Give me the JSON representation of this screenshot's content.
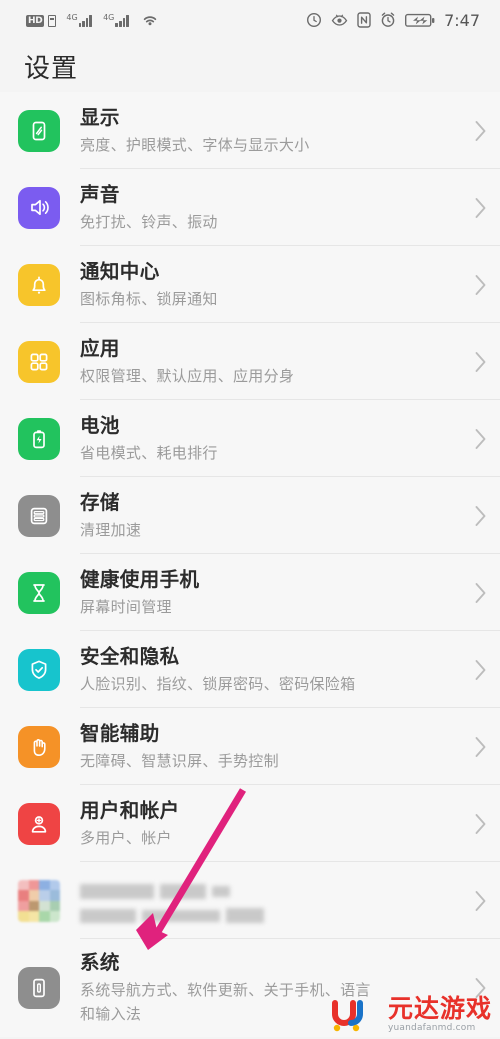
{
  "status_bar": {
    "hd_label": "HD",
    "sim_icon": "sim-card-icon",
    "network_1": "4G",
    "network_2": "4G",
    "wifi_icon": "wifi-icon",
    "right_icons": [
      "data-saver-icon",
      "eye-comfort-icon",
      "nfc-icon",
      "alarm-icon",
      "battery-charging-icon"
    ],
    "time": "7:47"
  },
  "header": {
    "title": "设置"
  },
  "list": {
    "items": [
      {
        "name": "display",
        "title": "显示",
        "subtitle": "亮度、护眼模式、字体与显示大小",
        "icon": "display-icon",
        "icon_color": "#22c35e",
        "blurred": false
      },
      {
        "name": "sound",
        "title": "声音",
        "subtitle": "免打扰、铃声、振动",
        "icon": "speaker-icon",
        "icon_color": "#7b5cf0",
        "blurred": false
      },
      {
        "name": "notification-center",
        "title": "通知中心",
        "subtitle": "图标角标、锁屏通知",
        "icon": "bell-icon",
        "icon_color": "#f7c52b",
        "blurred": false
      },
      {
        "name": "apps",
        "title": "应用",
        "subtitle": "权限管理、默认应用、应用分身",
        "icon": "apps-grid-icon",
        "icon_color": "#f7c52b",
        "blurred": false
      },
      {
        "name": "battery",
        "title": "电池",
        "subtitle": "省电模式、耗电排行",
        "icon": "battery-icon",
        "icon_color": "#22c35e",
        "blurred": false
      },
      {
        "name": "storage",
        "title": "存储",
        "subtitle": "清理加速",
        "icon": "storage-icon",
        "icon_color": "#8e8e8e",
        "blurred": false
      },
      {
        "name": "digital-balance",
        "title": "健康使用手机",
        "subtitle": "屏幕时间管理",
        "icon": "hourglass-icon",
        "icon_color": "#22c35e",
        "blurred": false
      },
      {
        "name": "security-privacy",
        "title": "安全和隐私",
        "subtitle": "人脸识别、指纹、锁屏密码、密码保险箱",
        "icon": "shield-check-icon",
        "icon_color": "#17c4cd",
        "blurred": false
      },
      {
        "name": "smart-assistance",
        "title": "智能辅助",
        "subtitle": "无障碍、智慧识屏、手势控制",
        "icon": "hand-icon",
        "icon_color": "#f59227",
        "blurred": false
      },
      {
        "name": "users-accounts",
        "title": "用户和帐户",
        "subtitle": "多用户、帐户",
        "icon": "user-add-icon",
        "icon_color": "#ef4444",
        "blurred": false
      },
      {
        "name": "blurred-entry",
        "title": "",
        "subtitle": "",
        "icon": "multicolor-mosaic-icon",
        "icon_color": "#cccccc",
        "blurred": true
      },
      {
        "name": "system",
        "title": "系统",
        "subtitle": "系统导航方式、软件更新、关于手机、语言和输入法",
        "icon": "system-phone-icon",
        "icon_color": "#8e8e8e",
        "blurred": false
      }
    ]
  },
  "annotation": {
    "arrow_color": "#e0227d",
    "arrow_label": "arrow-pointing-to-system"
  },
  "watermark": {
    "brand": "元达游戏",
    "url": "yuandafanmd.com"
  },
  "colors": {
    "background": "#f4f4f4",
    "list_background": "#f7f7f7",
    "title": "#2c2c2c",
    "subtitle": "#9b9b9b",
    "divider": "#e6e6e6",
    "chevron": "#bdbdbd"
  }
}
